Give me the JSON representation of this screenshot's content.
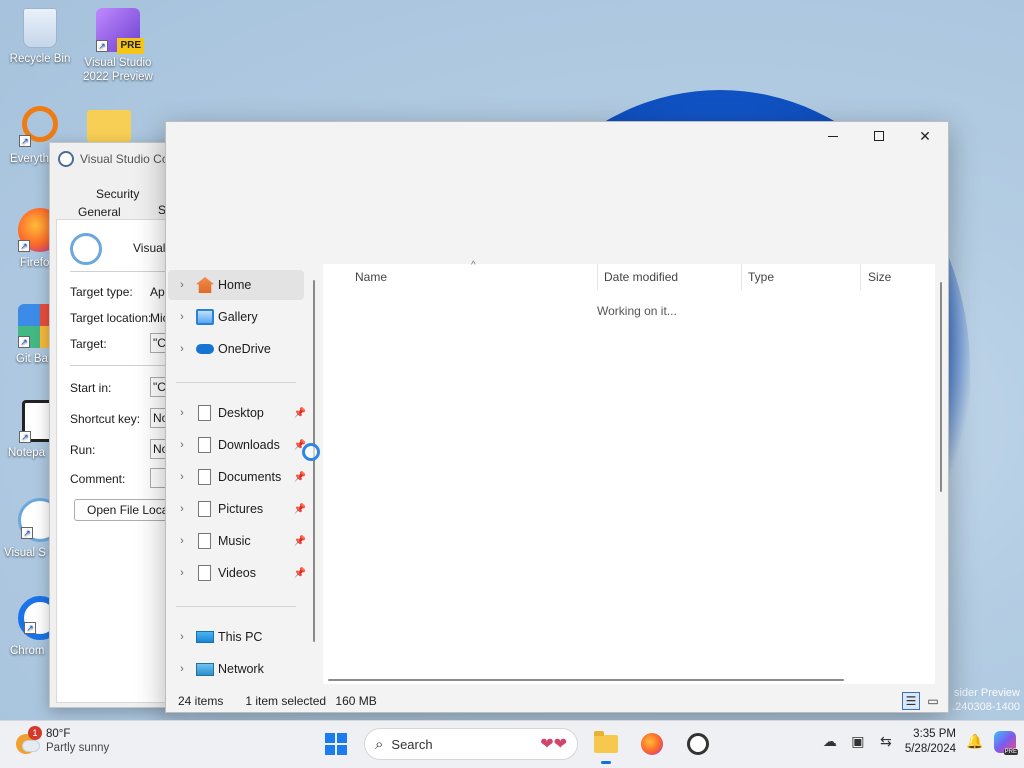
{
  "desktop": {
    "icons": [
      {
        "label": "Recycle Bin"
      },
      {
        "label": "Visual Studio 2022 Preview",
        "badge": "PRE"
      },
      {
        "label": "Everyth"
      },
      {
        "label": "Firefo"
      },
      {
        "label": "Git Ba"
      },
      {
        "label": "Notepa"
      },
      {
        "label": "Visual S Cod"
      },
      {
        "label": "Chrom"
      }
    ],
    "watermark_line1": "sider Preview",
    "watermark_line2": ".240308-1400"
  },
  "properties_dialog": {
    "title": "Visual Studio Co",
    "tabs": {
      "security": "Security",
      "general": "General",
      "shortcut": "S"
    },
    "app_name": "Visual",
    "fields": [
      {
        "label": "Target type:",
        "value": "App"
      },
      {
        "label": "Target location:",
        "value": "Mic"
      },
      {
        "label": "Target:",
        "value": "\"C"
      },
      {
        "label": "Start in:",
        "value": "\"C"
      },
      {
        "label": "Shortcut key:",
        "value": "No"
      },
      {
        "label": "Run:",
        "value": "No"
      },
      {
        "label": "Comment:",
        "value": ""
      }
    ],
    "open_file_location": "Open File Locatio"
  },
  "explorer": {
    "nav": {
      "home": "Home",
      "gallery": "Gallery",
      "onedrive": "OneDrive",
      "desktop": "Desktop",
      "downloads": "Downloads",
      "documents": "Documents",
      "pictures": "Pictures",
      "music": "Music",
      "videos": "Videos",
      "this_pc": "This PC",
      "network": "Network"
    },
    "columns": {
      "name": "Name",
      "date_modified": "Date modified",
      "type": "Type",
      "size": "Size"
    },
    "status_message": "Working on it...",
    "statusbar": {
      "items": "24 items",
      "selected": "1 item selected",
      "size": "160 MB"
    }
  },
  "taskbar": {
    "weather": {
      "temp": "80°F",
      "desc": "Partly sunny",
      "badge": "1"
    },
    "search_placeholder": "Search",
    "time": "3:35 PM",
    "date": "5/28/2024",
    "copilot_badge": "PRE"
  }
}
